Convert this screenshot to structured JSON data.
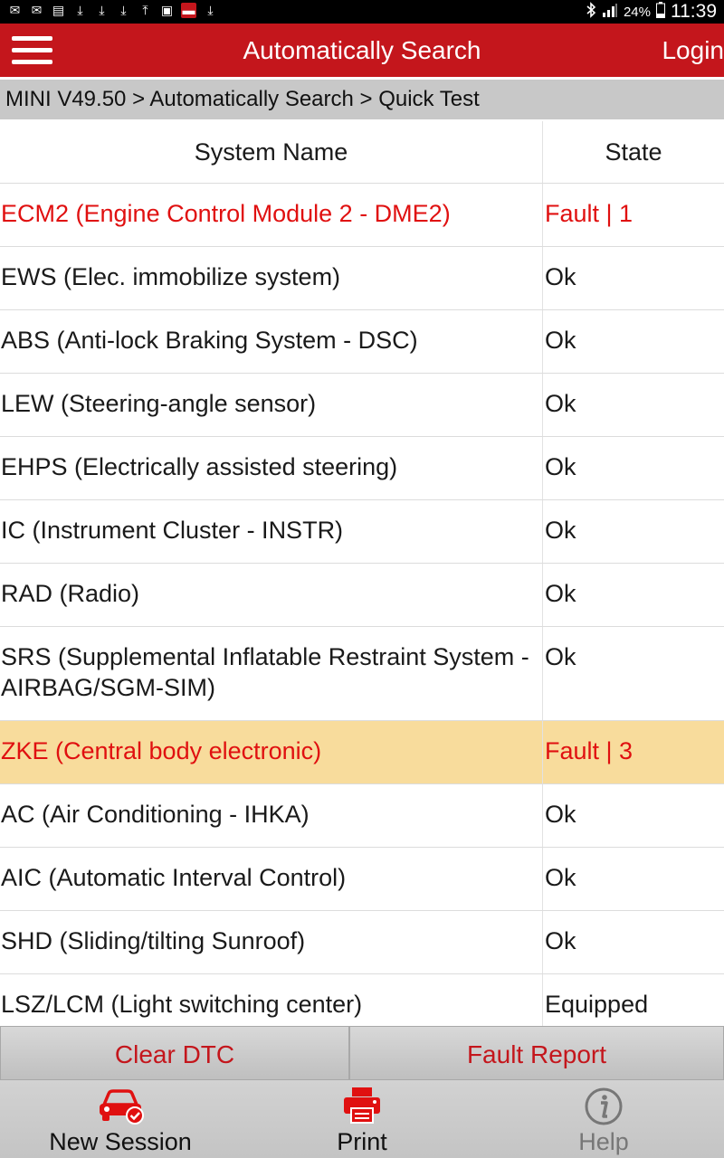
{
  "status_bar": {
    "battery": "24%",
    "time": "11:39",
    "icons_left": [
      "mail-x-icon",
      "mail-x-icon",
      "sim-icon",
      "download-icon",
      "download-icon",
      "download-icon",
      "upload-icon",
      "image-icon",
      "app-icon",
      "download-icon"
    ],
    "icons_right": [
      "bluetooth-icon",
      "signal-icon",
      "battery-icon"
    ]
  },
  "header": {
    "title": "Automatically Search",
    "login_label": "Login",
    "color": "#c4161c"
  },
  "breadcrumb": "MINI V49.50 > Automatically Search > Quick Test",
  "table": {
    "columns": [
      "System Name",
      "State"
    ],
    "rows": [
      {
        "name": "ECM2 (Engine Control Module 2 - DME2)",
        "state": "Fault | 1",
        "status": "fault"
      },
      {
        "name": "EWS (Elec. immobilize system)",
        "state": "Ok",
        "status": "ok"
      },
      {
        "name": "ABS (Anti-lock Braking System - DSC)",
        "state": "Ok",
        "status": "ok"
      },
      {
        "name": "LEW (Steering-angle sensor)",
        "state": "Ok",
        "status": "ok"
      },
      {
        "name": "EHPS (Electrically assisted steering)",
        "state": "Ok",
        "status": "ok"
      },
      {
        "name": "IC (Instrument Cluster - INSTR)",
        "state": "Ok",
        "status": "ok"
      },
      {
        "name": "RAD (Radio)",
        "state": "Ok",
        "status": "ok"
      },
      {
        "name": "SRS (Supplemental Inflatable Restraint System - AIRBAG/SGM-SIM)",
        "state": "Ok",
        "status": "ok"
      },
      {
        "name": "ZKE (Central body electronic)",
        "state": "Fault | 3",
        "status": "fault",
        "selected": true
      },
      {
        "name": "AC (Air Conditioning - IHKA)",
        "state": "Ok",
        "status": "ok"
      },
      {
        "name": "AIC (Automatic Interval Control)",
        "state": "Ok",
        "status": "ok"
      },
      {
        "name": "SHD (Sliding/tilting Sunroof)",
        "state": "Ok",
        "status": "ok"
      },
      {
        "name": "LSZ/LCM (Light switching center)",
        "state": "Equipped",
        "status": "ok"
      }
    ],
    "fault_color": "#e01010",
    "selected_color": "#f8dc9c"
  },
  "actions": {
    "clear_dtc": "Clear DTC",
    "fault_report": "Fault Report"
  },
  "bottom_nav": [
    {
      "label": "New Session",
      "icon": "car-check-icon"
    },
    {
      "label": "Print",
      "icon": "printer-icon"
    },
    {
      "label": "Help",
      "icon": "info-icon",
      "disabled": true
    }
  ]
}
